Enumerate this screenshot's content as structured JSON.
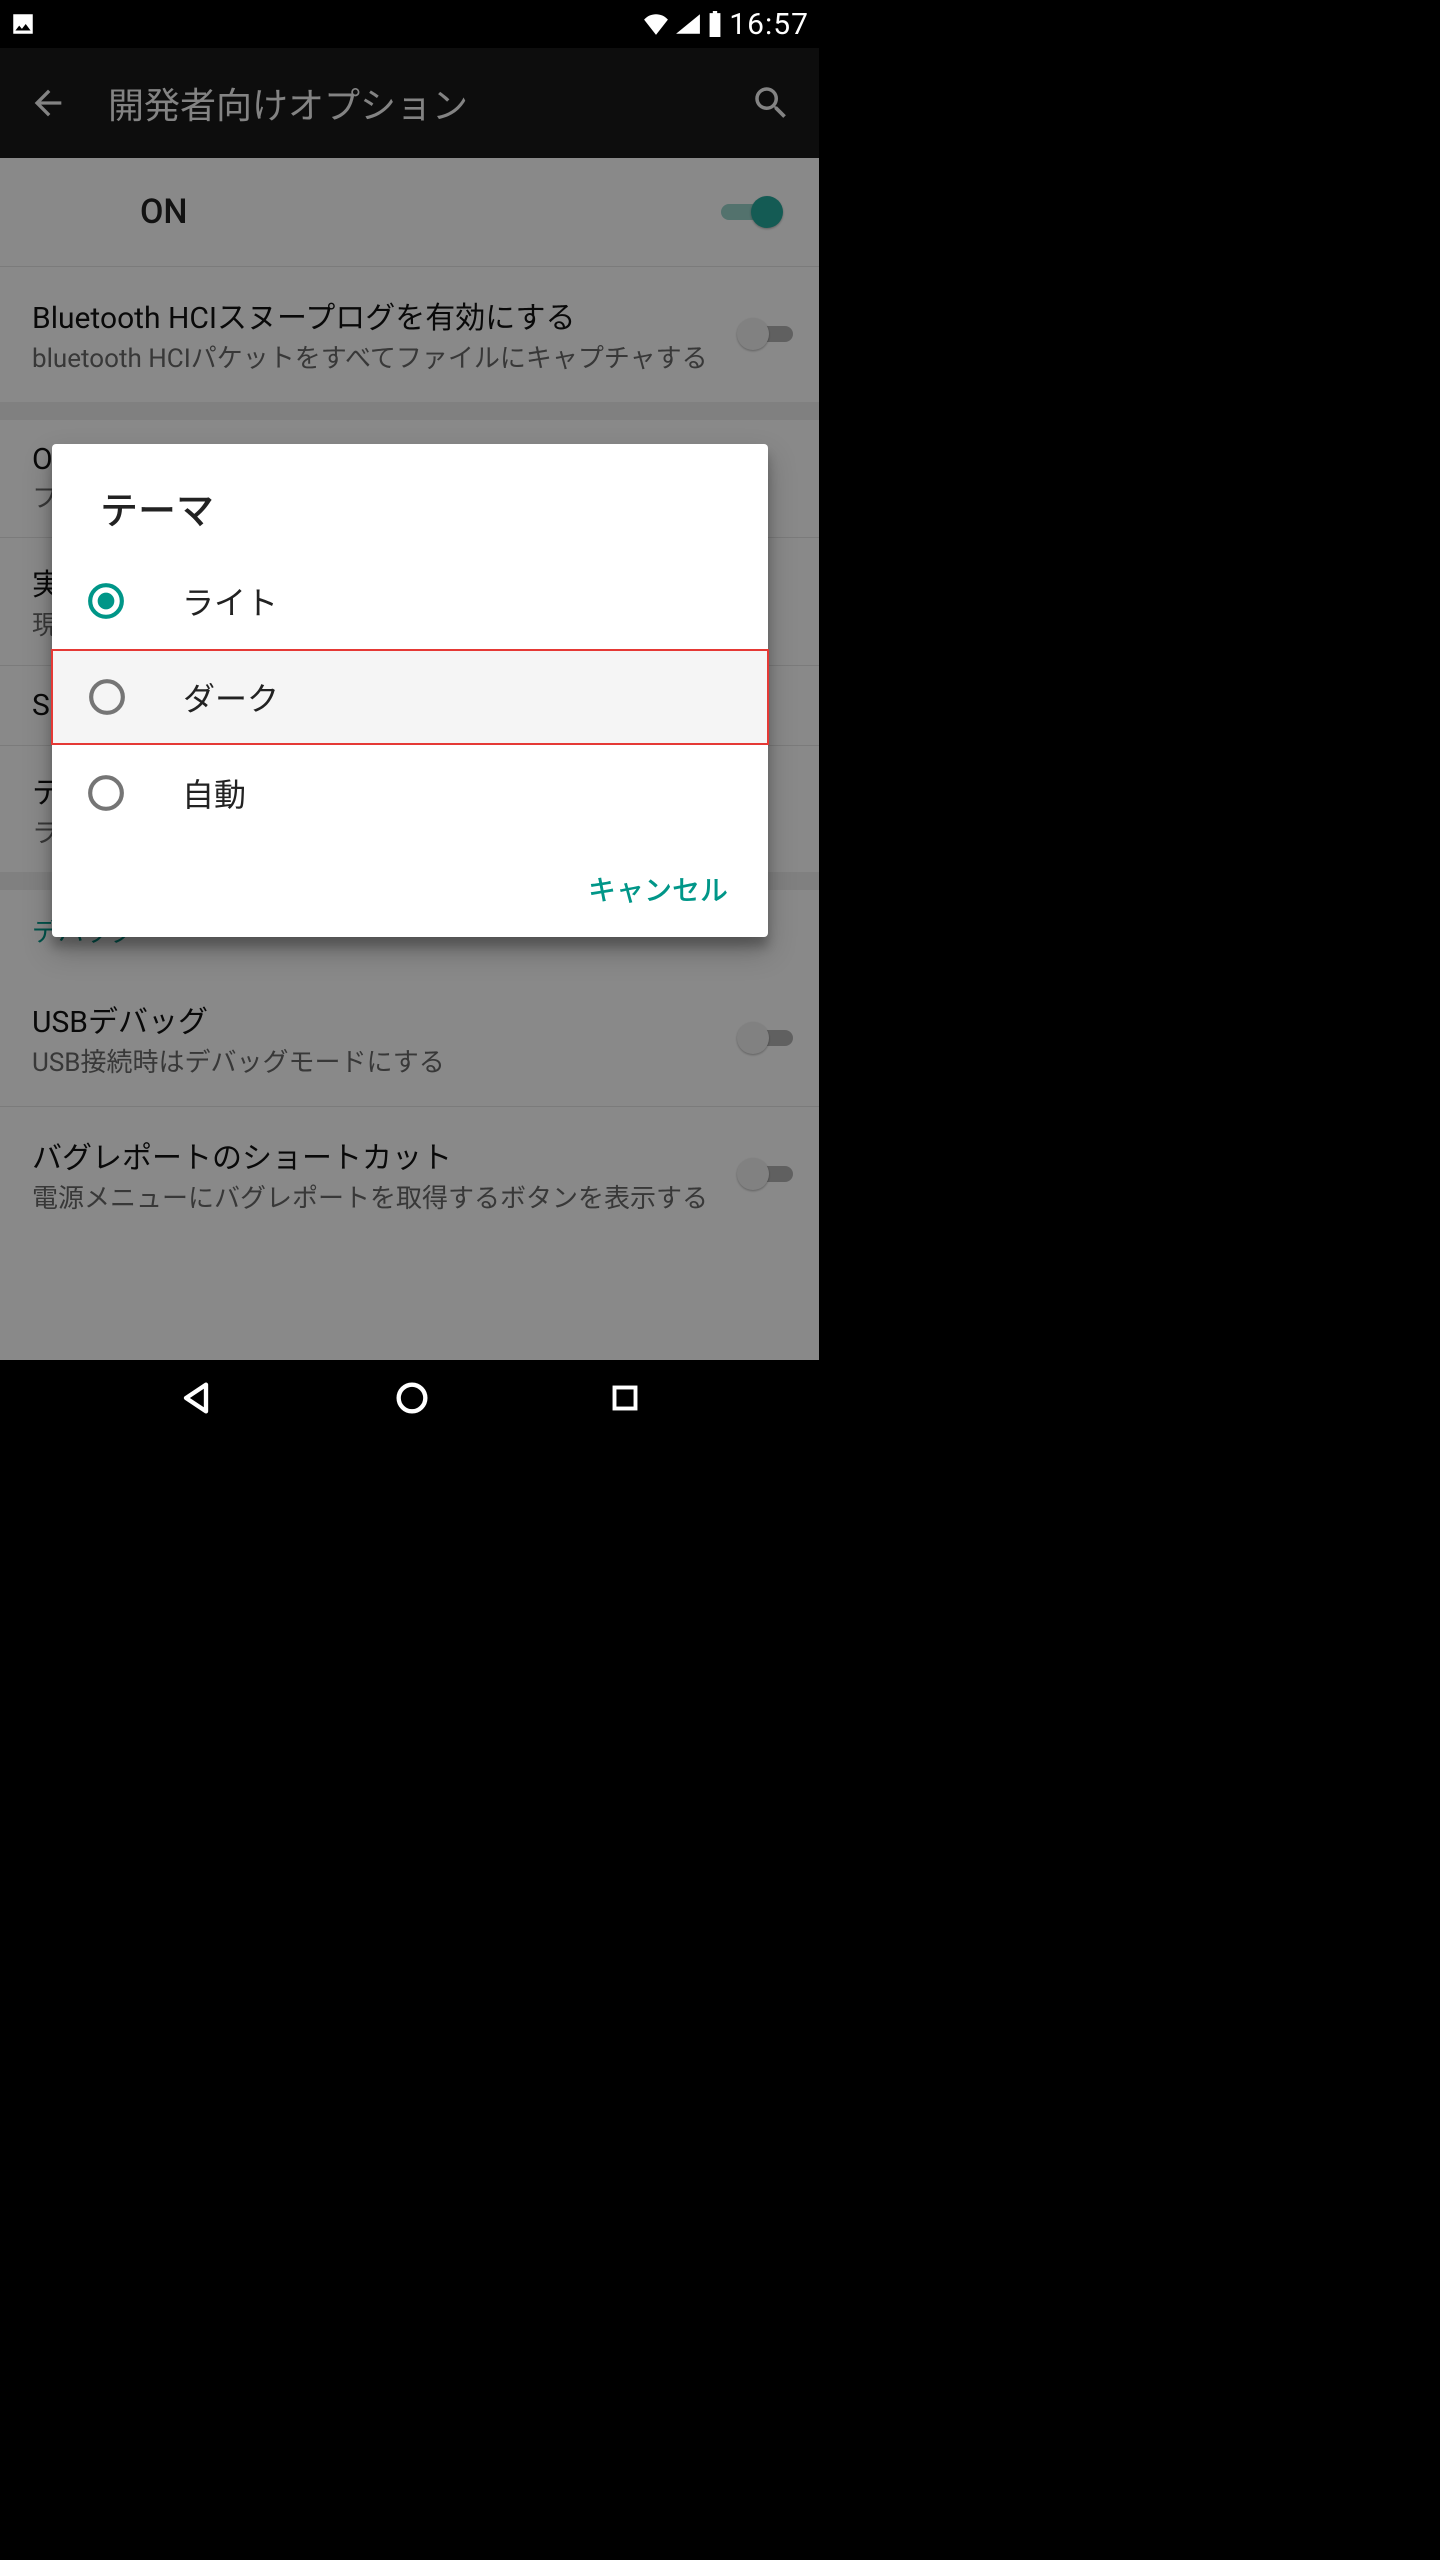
{
  "statusbar": {
    "time": "16:57"
  },
  "appbar": {
    "title": "開発者向けオプション"
  },
  "toggle_on": {
    "label": "ON",
    "state": true
  },
  "settings": [
    {
      "title": "Bluetooth HCIスヌープログを有効にする",
      "subtitle": "bluetooth HCIパケットをすべてファイルにキャプチャする",
      "switch": false
    },
    {
      "title_fragment_char": "O",
      "subtitle_fragment_char": "フ"
    },
    {
      "title_fragment_char": "実",
      "subtitle_fragment_char": "現"
    },
    {
      "title_fragment_char": "S"
    },
    {
      "title_fragment_char": "テ",
      "subtitle_fragment_char": "ラ"
    },
    {
      "section_label": "デバッグ"
    },
    {
      "title": "USBデバッグ",
      "subtitle": "USB接続時はデバッグモードにする",
      "switch": false
    },
    {
      "title": "バグレポートのショートカット",
      "subtitle": "電源メニューにバグレポートを取得するボタンを表示する",
      "switch": false
    }
  ],
  "dialog": {
    "title": "テーマ",
    "options": [
      {
        "label": "ライト",
        "selected": true,
        "highlighted": false
      },
      {
        "label": "ダーク",
        "selected": false,
        "highlighted": true
      },
      {
        "label": "自動",
        "selected": false,
        "highlighted": false
      }
    ],
    "cancel": "キャンセル"
  },
  "colors": {
    "accent": "#009688"
  }
}
